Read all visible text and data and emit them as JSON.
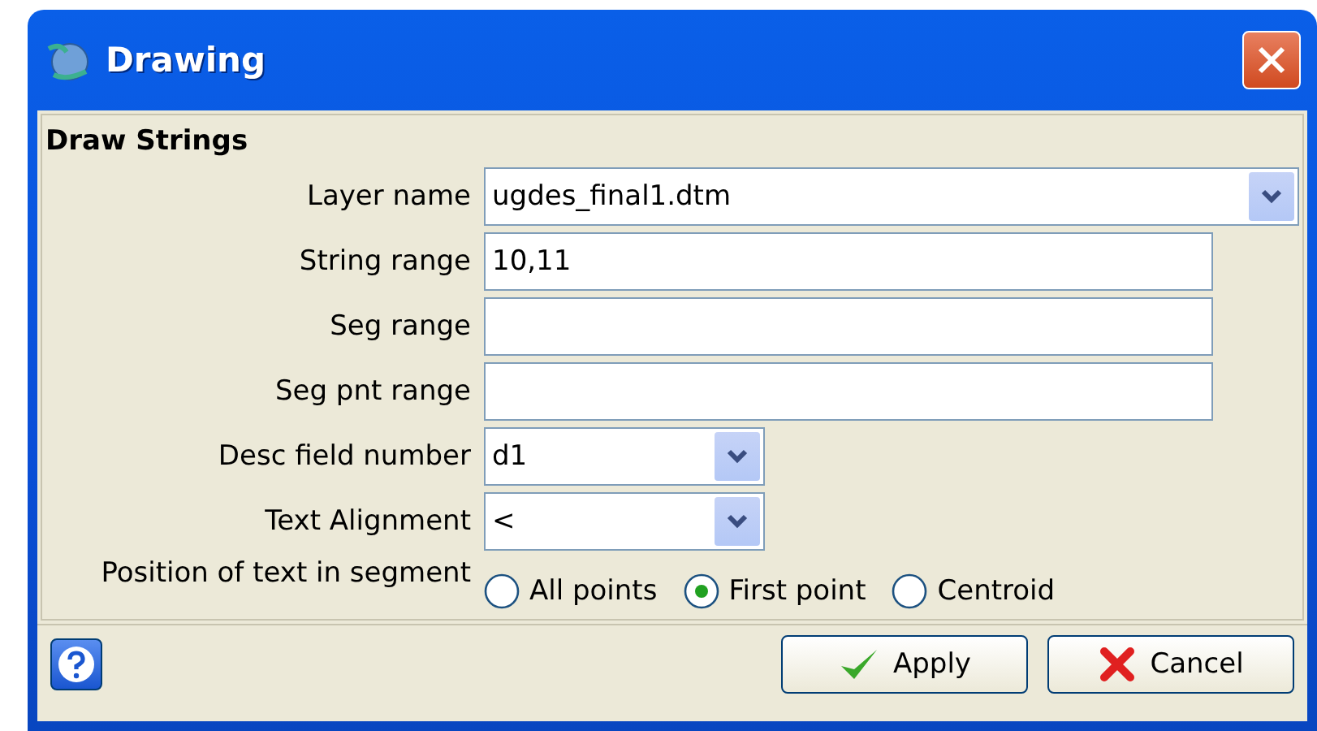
{
  "window": {
    "title": "Drawing"
  },
  "section": {
    "title": "Draw Strings"
  },
  "fields": [
    {
      "label": "Layer name",
      "kind": "combo",
      "value": "ugdes_final1.dtm"
    },
    {
      "label": "String range",
      "kind": "text",
      "value": "10,11"
    },
    {
      "label": "Seg range",
      "kind": "text"
    },
    {
      "label": "Seg pnt range",
      "kind": "text"
    },
    {
      "label": "Desc field number",
      "kind": "combo",
      "value": "d1"
    },
    {
      "label": "Text Alignment",
      "kind": "combo",
      "value": "<"
    }
  ],
  "position": {
    "label": "Position of text in segment",
    "options": [
      {
        "label": "All points",
        "selected": false
      },
      {
        "label": "First point",
        "selected": true
      },
      {
        "label": "Centroid",
        "selected": false
      }
    ]
  },
  "buttons": [
    {
      "label": "Apply",
      "kind": "apply"
    },
    {
      "label": "Cancel",
      "kind": "cancel"
    }
  ]
}
